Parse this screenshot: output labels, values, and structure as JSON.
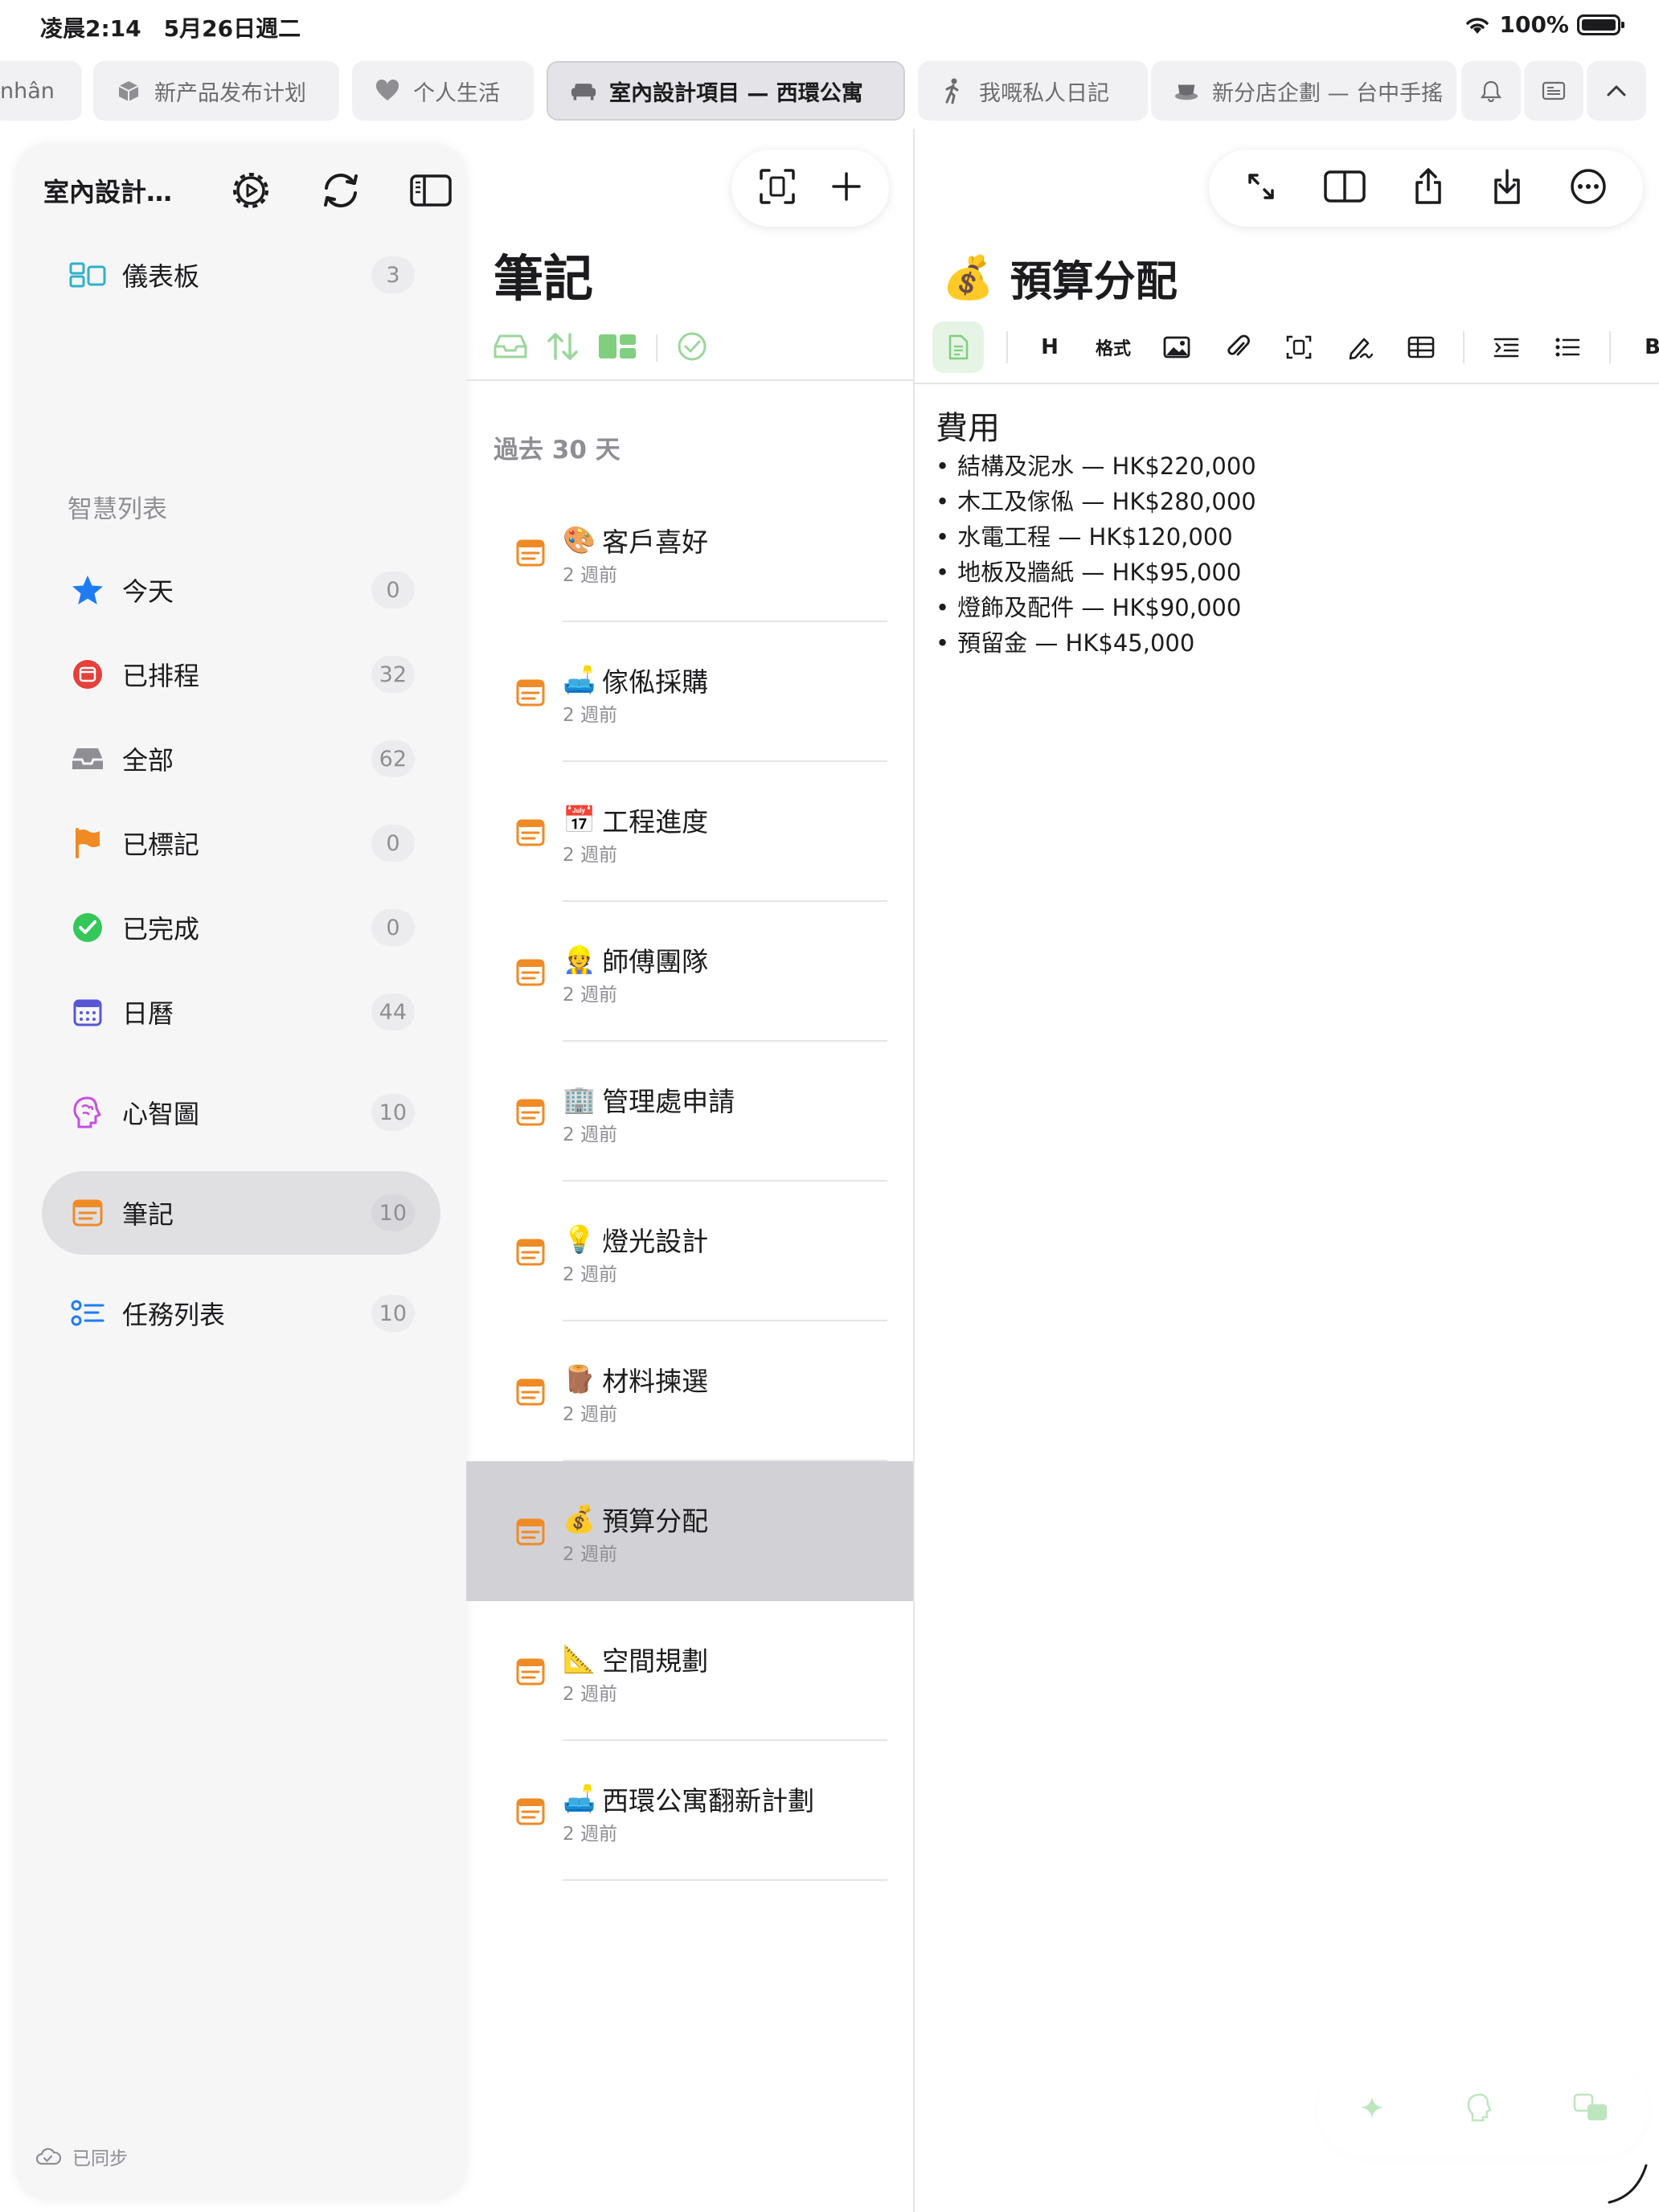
{
  "status_bar": {
    "time": "凌晨2:14　5月26日週二",
    "battery": "100%"
  },
  "tabs": [
    {
      "label": "nhân",
      "icon": "none"
    },
    {
      "label": "新产品发布计划",
      "icon": "box-icon"
    },
    {
      "label": "个人生活",
      "icon": "heart-icon"
    },
    {
      "label": "室內設計項目 — 西環公寓",
      "icon": "sofa-icon",
      "active": true
    },
    {
      "label": "我嘅私人日記",
      "icon": "walker-icon"
    },
    {
      "label": "新分店企劃 — 台中手搖",
      "icon": "cup-icon"
    }
  ],
  "sidebar": {
    "title": "室內設計…",
    "items_top": [
      {
        "label": "儀表板",
        "count": "3",
        "icon": "dashboard-icon"
      }
    ],
    "section_label": "智慧列表",
    "smart_lists": [
      {
        "label": "今天",
        "count": "0",
        "icon": "star-icon"
      },
      {
        "label": "已排程",
        "count": "32",
        "icon": "calendar-badge-icon"
      },
      {
        "label": "全部",
        "count": "62",
        "icon": "tray-icon"
      },
      {
        "label": "已標記",
        "count": "0",
        "icon": "flag-icon"
      },
      {
        "label": "已完成",
        "count": "0",
        "icon": "checkmark-icon"
      },
      {
        "label": "日曆",
        "count": "44",
        "icon": "calendar-icon"
      }
    ],
    "other": [
      {
        "label": "心智圖",
        "count": "10",
        "icon": "brain-icon"
      },
      {
        "label": "筆記",
        "count": "10",
        "icon": "note-icon",
        "selected": true
      },
      {
        "label": "任務列表",
        "count": "10",
        "icon": "checklist-icon"
      }
    ],
    "sync_status": "已同步"
  },
  "notes_pane": {
    "title": "筆記",
    "section": "過去 30 天",
    "notes": [
      {
        "emoji": "🎨",
        "title": "客戶喜好",
        "time": "2 週前"
      },
      {
        "emoji": "🛋️",
        "title": "傢俬採購",
        "time": "2 週前"
      },
      {
        "emoji": "📅",
        "title": "工程進度",
        "time": "2 週前"
      },
      {
        "emoji": "👷",
        "title": "師傅團隊",
        "time": "2 週前"
      },
      {
        "emoji": "🏢",
        "title": "管理處申請",
        "time": "2 週前"
      },
      {
        "emoji": "💡",
        "title": "燈光設計",
        "time": "2 週前"
      },
      {
        "emoji": "🪵",
        "title": "材料揀選",
        "time": "2 週前"
      },
      {
        "emoji": "💰",
        "title": "預算分配",
        "time": "2 週前",
        "selected": true
      },
      {
        "emoji": "📐",
        "title": "空間規劃",
        "time": "2 週前"
      },
      {
        "emoji": "🛋️",
        "title": "西環公寓翻新計劃",
        "time": "2 週前"
      }
    ]
  },
  "editor": {
    "emoji": "💰",
    "title": "預算分配",
    "format_labels": {
      "heading": "H",
      "format": "格式",
      "bold": "B"
    },
    "heading": "費用",
    "items": [
      "結構及泥水 — HK$220,000",
      "木工及傢俬 — HK$280,000",
      "水電工程 — HK$120,000",
      "地板及牆紙 — HK$95,000",
      "燈飾及配件 — HK$90,000",
      "預留金 — HK$45,000"
    ]
  },
  "colors": {
    "accent_orange": "#f08a24",
    "accent_green": "#34c759",
    "accent_blue": "#1e7cf2",
    "accent_red": "#e5403a",
    "accent_purple": "#5856d6",
    "accent_magenta": "#c74fe0",
    "accent_teal": "#30b0c7"
  }
}
